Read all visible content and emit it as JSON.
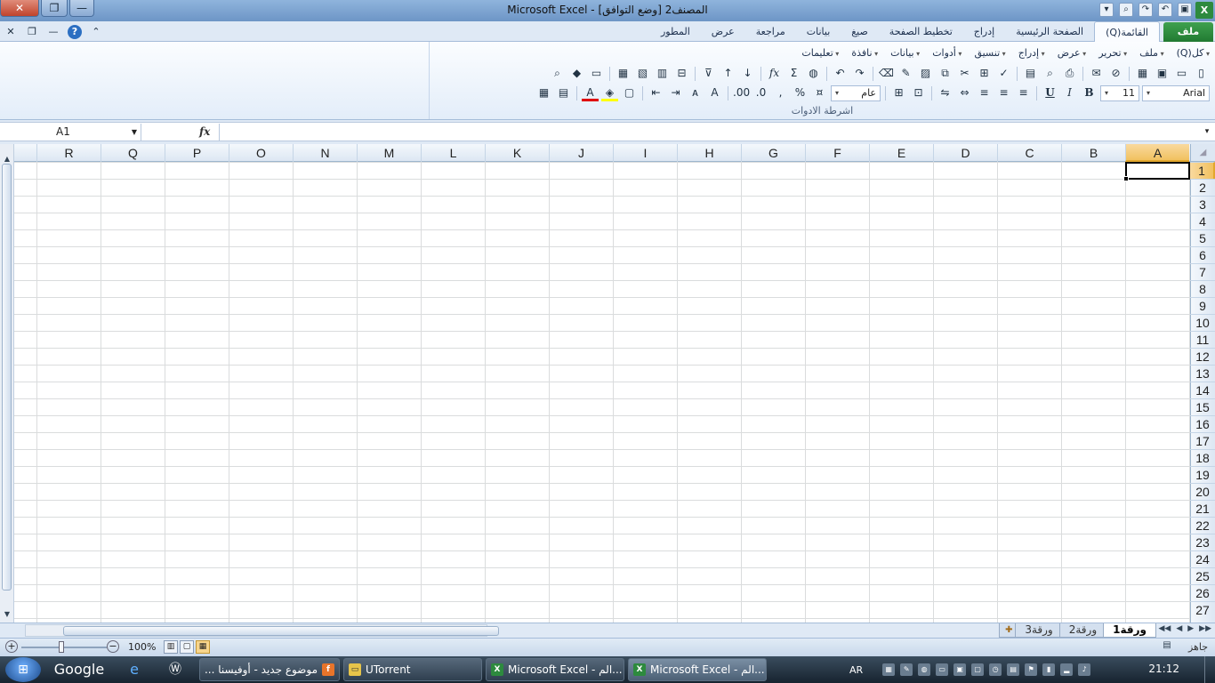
{
  "window": {
    "title": "المصنف2  [وضع التوافق] - Microsoft Excel",
    "close_label": "✕",
    "restore_label": "❐",
    "minimize_label": "—",
    "app_icon_label": "X"
  },
  "ribbon": {
    "file_tab": "ملف",
    "tabs": [
      "(Q)القائمة",
      "الصفحة الرئيسية",
      "إدراج",
      "تخطيط الصفحة",
      "صيغ",
      "بيانات",
      "مراجعة",
      "عرض",
      "المطور"
    ],
    "menus": [
      "(Q)كل",
      "ملف",
      "تحرير",
      "عرض",
      "إدراج",
      "تنسيق",
      "أدوات",
      "بيانات",
      "نافذة",
      "تعليمات"
    ],
    "font_name": "Arial",
    "font_size": "11",
    "number_format": "عام",
    "group_label": "اشرطة الادوات"
  },
  "formula_bar": {
    "name_box": "A1",
    "fx": "fx",
    "formula": ""
  },
  "grid": {
    "columns": [
      "A",
      "B",
      "C",
      "D",
      "E",
      "F",
      "G",
      "H",
      "I",
      "J",
      "K",
      "L",
      "M",
      "N",
      "O",
      "P",
      "Q",
      "R"
    ],
    "rows": [
      "1",
      "2",
      "3",
      "4",
      "5",
      "6",
      "7",
      "8",
      "9",
      "10",
      "11",
      "12",
      "13",
      "14",
      "15",
      "16",
      "17",
      "18",
      "19",
      "20",
      "21",
      "22",
      "23",
      "24",
      "25",
      "26",
      "27"
    ],
    "selected_column": "A",
    "selected_row": "1"
  },
  "sheets": {
    "tabs": [
      "ورقة1",
      "ورقة2",
      "ورقة3"
    ],
    "active": "ورقة1"
  },
  "status": {
    "ready": "جاهز",
    "zoom": "100%"
  },
  "taskbar": {
    "pinned": [
      "Google"
    ],
    "buttons": [
      "موضوع جديد - أوفيسنا ...",
      "UTorrent",
      "Microsoft Excel - الم...",
      "Microsoft Excel - الم..."
    ],
    "language": "AR",
    "clock": "21:12"
  },
  "colors": {
    "accent": "#217a32",
    "selection_header": "#f1c15f",
    "ribbon_bg": "#dfe9f5"
  }
}
